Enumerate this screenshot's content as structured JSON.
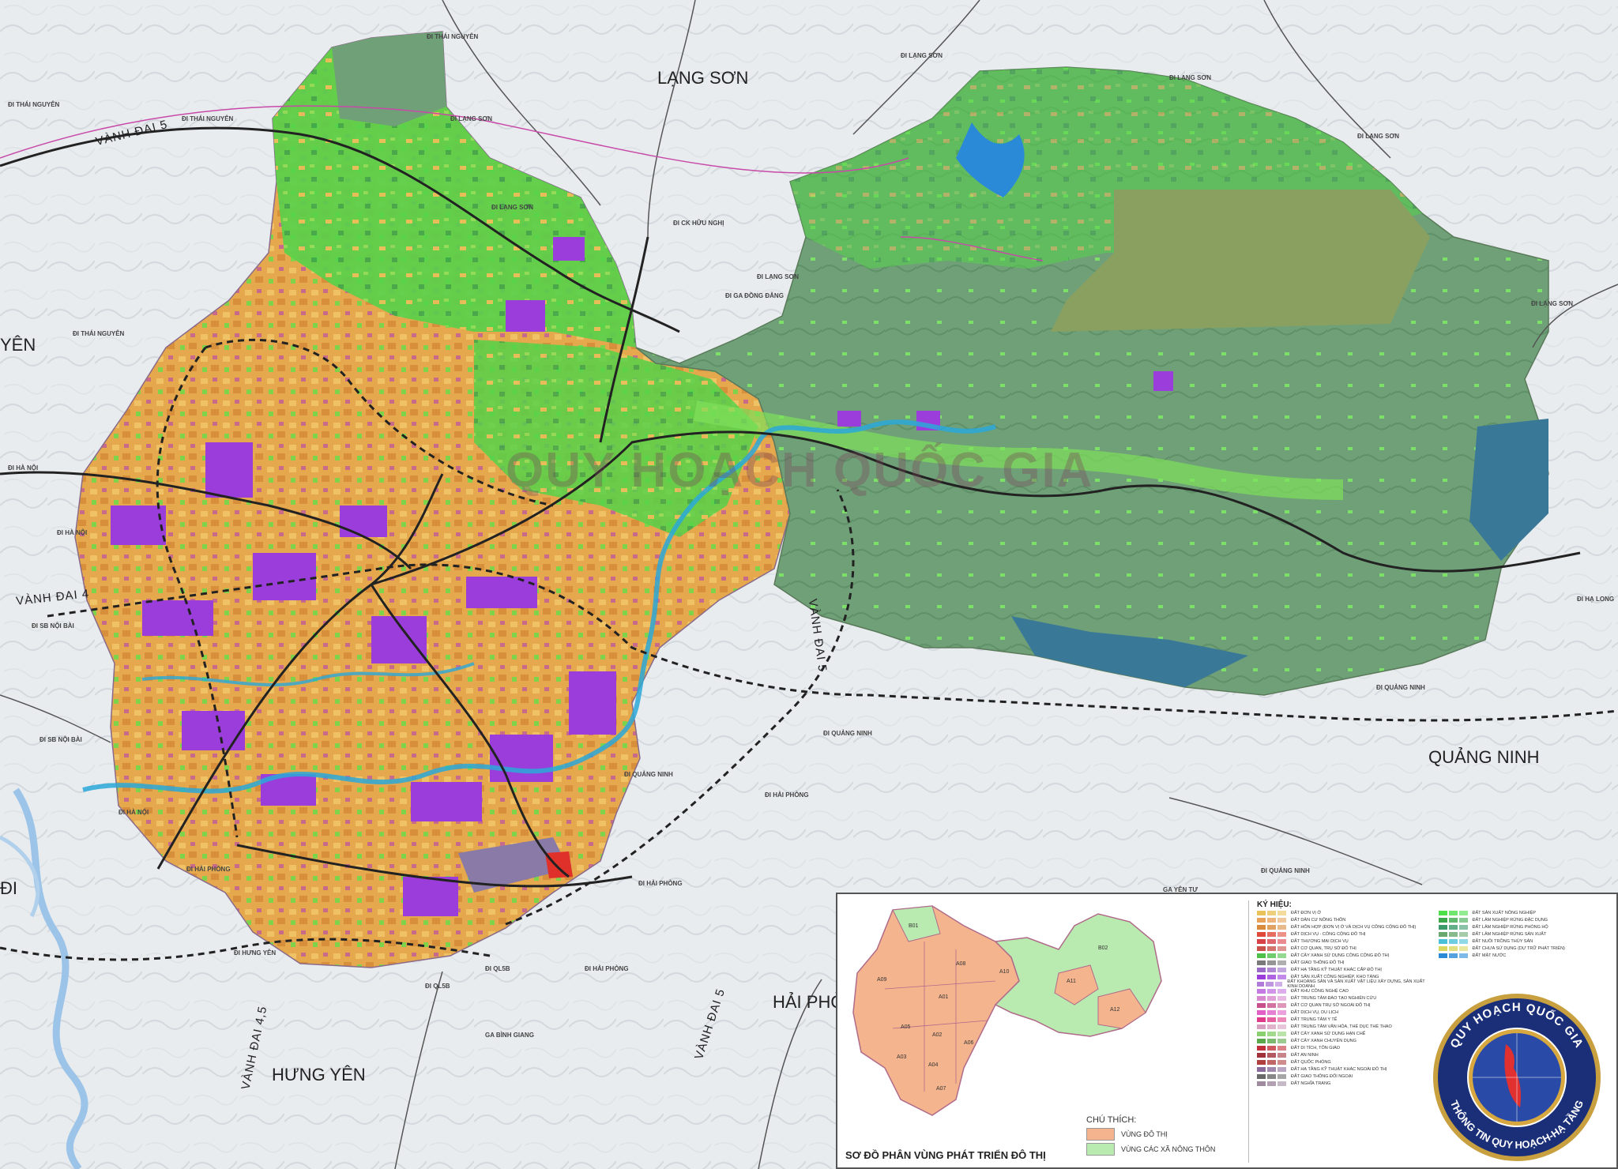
{
  "labels": {
    "lang_son": "LẠNG SƠN",
    "quang_ninh": "QUẢNG NINH",
    "hai_phong": "HẢI PHÒNG",
    "hung_yen": "HƯNG YÊN",
    "yen": "YÊN",
    "hai_partial": "ĐI",
    "vanh_dai_5_top": "VÀNH ĐAI 5",
    "vanh_dai_5_mid": "VÀNH ĐAI 5",
    "vanh_dai_5_bottom": "VÀNH ĐAI 5",
    "vanh_dai_4": "VÀNH ĐAI 4",
    "vanh_dai_45": "VÀNH ĐAI 4,5"
  },
  "destinations": [
    "ĐI THÁI NGUYÊN",
    "ĐI THÁI NGUYÊN",
    "ĐI THÁI NGUYÊN",
    "ĐI THÁI NGUYÊN",
    "ĐI LẠNG SƠN",
    "ĐI LẠNG SƠN",
    "ĐI LẠNG SƠN",
    "ĐI LẠNG SƠN",
    "ĐI LẠNG SƠN",
    "ĐI LẠNG SƠN",
    "ĐI LẠNG SƠN",
    "ĐI CK HỮU NGHỊ",
    "ĐI GA ĐỒNG ĐĂNG",
    "ĐI HÀ NỘI",
    "ĐI HÀ NỘI",
    "ĐI HÀ NỘI",
    "ĐI SB NỘI BÀI",
    "ĐI SB NỘI BÀI",
    "ĐI QUẢNG NINH",
    "ĐI QUẢNG NINH",
    "ĐI QUẢNG NINH",
    "ĐI QUẢNG NINH",
    "ĐI HẠ LONG",
    "ĐI HẢI PHÒNG",
    "ĐI HẢI PHÒNG",
    "ĐI HẢI PHÒNG",
    "ĐI HẢI PHÒNG",
    "ĐI QL5B",
    "ĐI QL5B",
    "ĐI HƯNG YÊN",
    "GA YÊN TƯ",
    "GA BÌNH GIANG"
  ],
  "watermark": "QUY HOẠCH QUỐC GIA",
  "inset": {
    "title": "SƠ ĐỒ PHÂN VÙNG PHÁT TRIỂN ĐÔ THỊ",
    "legend_title": "CHÚ THÍCH:",
    "legend_items": [
      {
        "label": "VÙNG ĐÔ THỊ",
        "color": "#f4b58e"
      },
      {
        "label": "VÙNG CÁC XÃ NÔNG THÔN",
        "color": "#b9eab0"
      }
    ],
    "zones": [
      "B01",
      "B02",
      "A09",
      "A10",
      "A11",
      "A12",
      "A01",
      "A02",
      "A03",
      "A04",
      "A05",
      "A06",
      "A07",
      "A08"
    ]
  },
  "legend": {
    "title": "KÝ HIỆU:",
    "left": [
      {
        "label": "ĐẤT ĐƠN VỊ Ở",
        "color": "#e9c35a"
      },
      {
        "label": "ĐẤT DÂN CƯ NÔNG THÔN",
        "color": "#e8a25a"
      },
      {
        "label": "ĐẤT HỖN HỢP (ĐƠN VỊ Ở VÀ DỊCH VỤ CÔNG CỘNG ĐÔ THỊ)",
        "color": "#d98a3a"
      },
      {
        "label": "ĐẤT DỊCH VỤ - CÔNG CỘNG ĐÔ THỊ",
        "color": "#e04a3a"
      },
      {
        "label": "ĐẤT THƯƠNG MẠI DỊCH VỤ",
        "color": "#d8404a"
      },
      {
        "label": "ĐẤT CƠ QUAN, TRỤ SỞ ĐÔ THỊ",
        "color": "#c8504a"
      },
      {
        "label": "ĐẤT CÂY XANH SỬ DỤNG CÔNG CỘNG ĐÔ THỊ",
        "color": "#4cc04a"
      },
      {
        "label": "ĐẤT GIAO THÔNG ĐÔ THỊ",
        "color": "#7a7a7a"
      },
      {
        "label": "ĐẤT HẠ TẦNG KỸ THUẬT KHÁC CẤP ĐÔ THỊ",
        "color": "#9a6ac8"
      },
      {
        "label": "ĐẤT SẢN XUẤT CÔNG NGHIỆP, KHO TÀNG",
        "color": "#9b3ddb"
      },
      {
        "label": "ĐẤT KHOÁNG SẢN VÀ SẢN XUẤT VẬT LIỆU XÂY DỰNG, SẢN XUẤT KINH DOANH",
        "color": "#b07ad8"
      },
      {
        "label": "ĐẤT KHU CÔNG NGHỆ CAO",
        "color": "#c47ae0"
      },
      {
        "label": "ĐẤT TRUNG TÂM ĐÀO TẠO NGHIÊN CỨU",
        "color": "#d88ad0"
      },
      {
        "label": "ĐẤT CƠ QUAN TRỤ SỞ NGOÀI ĐÔ THỊ",
        "color": "#c8508a"
      },
      {
        "label": "ĐẤT DỊCH VỤ, DU LỊCH",
        "color": "#e060c8"
      },
      {
        "label": "ĐẤT TRUNG TÂM Y TẾ",
        "color": "#e03a8a"
      },
      {
        "label": "ĐẤT TRUNG TÂM VĂN HÓA, THỂ DỤC THỂ THAO",
        "color": "#d8a0c0"
      },
      {
        "label": "ĐẤT CÂY XANH SỬ DỤNG HẠN CHẾ",
        "color": "#8ad070"
      },
      {
        "label": "ĐẤT CÂY XANH CHUYÊN DỤNG",
        "color": "#5aa84a"
      },
      {
        "label": "ĐẤT DI TÍCH, TÔN GIÁO",
        "color": "#c0303a"
      },
      {
        "label": "ĐẤT AN NINH",
        "color": "#a0303a"
      },
      {
        "label": "ĐẤT QUỐC PHÒNG",
        "color": "#b04040"
      },
      {
        "label": "ĐẤT HẠ TẦNG KỸ THUẬT KHÁC NGOÀI ĐÔ THỊ",
        "color": "#8a6a9a"
      },
      {
        "label": "ĐẤT GIAO THÔNG ĐỐI NGOẠI",
        "color": "#6a6a6a"
      },
      {
        "label": "ĐẤT NGHĨA TRANG",
        "color": "#a08aa0"
      }
    ],
    "right": [
      {
        "label": "ĐẤT SẢN XUẤT NÔNG NGHIỆP",
        "color": "#4ce04a"
      },
      {
        "label": "ĐẤT LÂM NGHIỆP RỪNG ĐẶC DỤNG",
        "color": "#3aa84a"
      },
      {
        "label": "ĐẤT LÂM NGHIỆP RỪNG PHÒNG HỘ",
        "color": "#3a9a6a"
      },
      {
        "label": "ĐẤT LÂM NGHIỆP RỪNG SẢN XUẤT",
        "color": "#6aa870"
      },
      {
        "label": "ĐẤT NUÔI TRỒNG THỦY SẢN",
        "color": "#4ac0d8"
      },
      {
        "label": "ĐẤT CHƯA SỬ DỤNG (DỰ TRỮ PHÁT TRIỂN)",
        "color": "#d8d860"
      },
      {
        "label": "ĐẤT MẶT NƯỚC",
        "color": "#2a8ad8"
      }
    ]
  },
  "badge": {
    "top": "QUY HOẠCH QUỐC GIA",
    "bottom": "THÔNG TIN QUY HOẠCH-HẠ TẦNG"
  }
}
